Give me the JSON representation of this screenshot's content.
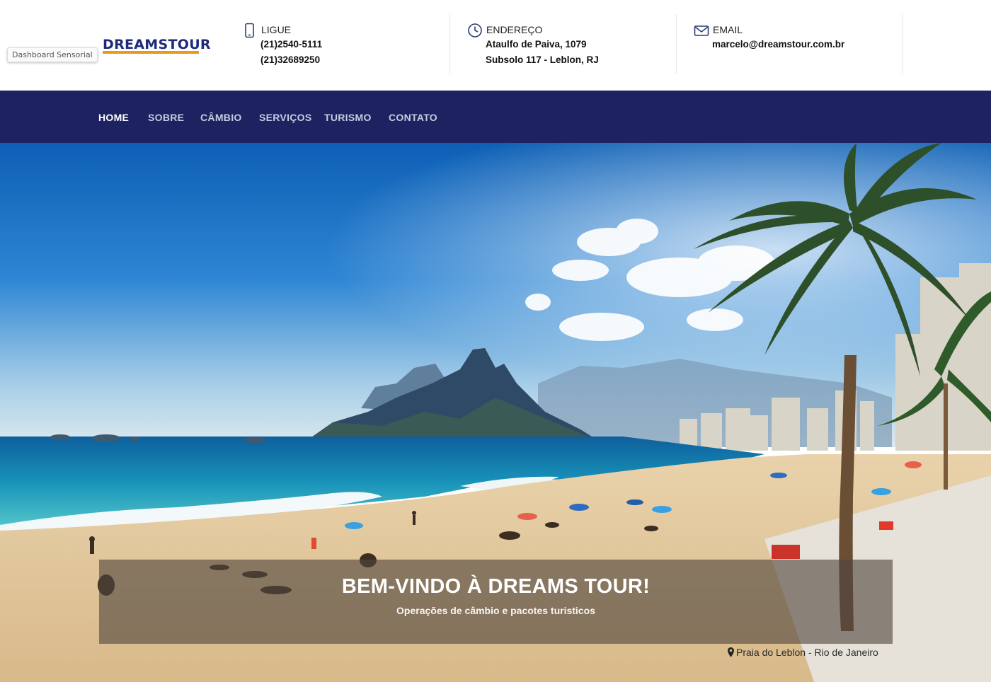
{
  "tooltip": "Dashboard Sensorial",
  "brand": {
    "logo_text": "DREAMSTOUR"
  },
  "contacts": {
    "phone": {
      "icon": "mobile-phone-icon",
      "label": "LIGUE",
      "line1": "(21)2540-5111",
      "line2": "(21)32689250"
    },
    "address": {
      "icon": "clock-icon",
      "label": "ENDEREÇO",
      "line1": "Ataulfo de Paiva, 1079",
      "line2": "Subsolo 117 - Leblon, RJ"
    },
    "email": {
      "icon": "envelope-icon",
      "label": "EMAIL",
      "line1": "marcelo@dreamstour.com.br"
    }
  },
  "nav": {
    "items": [
      {
        "label": "HOME",
        "active": true
      },
      {
        "label": "SOBRE"
      },
      {
        "label": "CÂMBIO"
      },
      {
        "label": "SERVIÇOS"
      },
      {
        "label": "TURISMO"
      },
      {
        "label": "CONTATO"
      }
    ]
  },
  "hero": {
    "title": "BEM-VINDO À DREAMS TOUR!",
    "subtitle": "Operações de câmbio e pacotes turisticos",
    "location": "Praia do Leblon - Rio de Janeiro",
    "location_icon": "map-pin-icon"
  },
  "colors": {
    "navbar": "#1c2360",
    "logo": "#1e2a7a",
    "logo_accent": "#e89a1e",
    "caption_overlay": "rgba(80,70,62,0.62)"
  }
}
